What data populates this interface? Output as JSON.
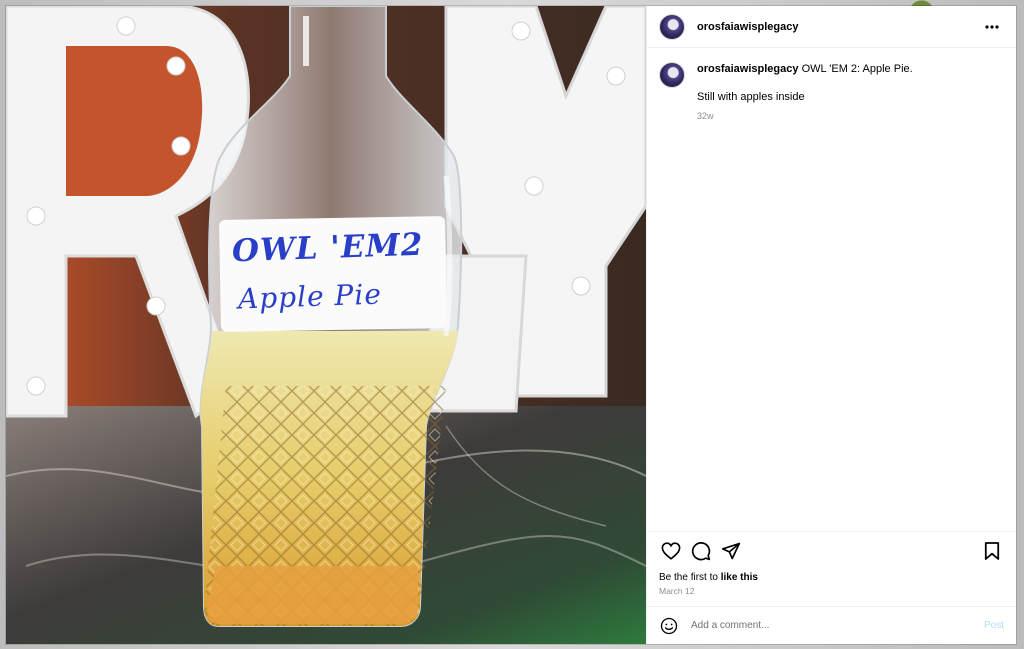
{
  "post": {
    "username": "orosfaiawisplegacy",
    "caption_title": "OWL 'EM 2: Apple Pie.",
    "caption_extra": "Still with apples inside",
    "caption_time": "32w",
    "likes_prefix": "Be the first to ",
    "likes_action": "like this",
    "date": "March 12",
    "bottle_label_line1": "OWL 'EM2",
    "bottle_label_line2": "Apple Pie"
  },
  "comment": {
    "placeholder": "Add a comment...",
    "post_label": "Post"
  },
  "icons": {
    "more": "more-options-icon",
    "like": "heart-icon",
    "comment": "comment-bubble-icon",
    "share": "share-paper-plane-icon",
    "save": "bookmark-icon",
    "emoji": "emoji-smiley-icon"
  },
  "colors": {
    "post_button": "#b2dffc",
    "secondary_text": "#8e8e8e",
    "label_ink": "#2a3fc7"
  }
}
